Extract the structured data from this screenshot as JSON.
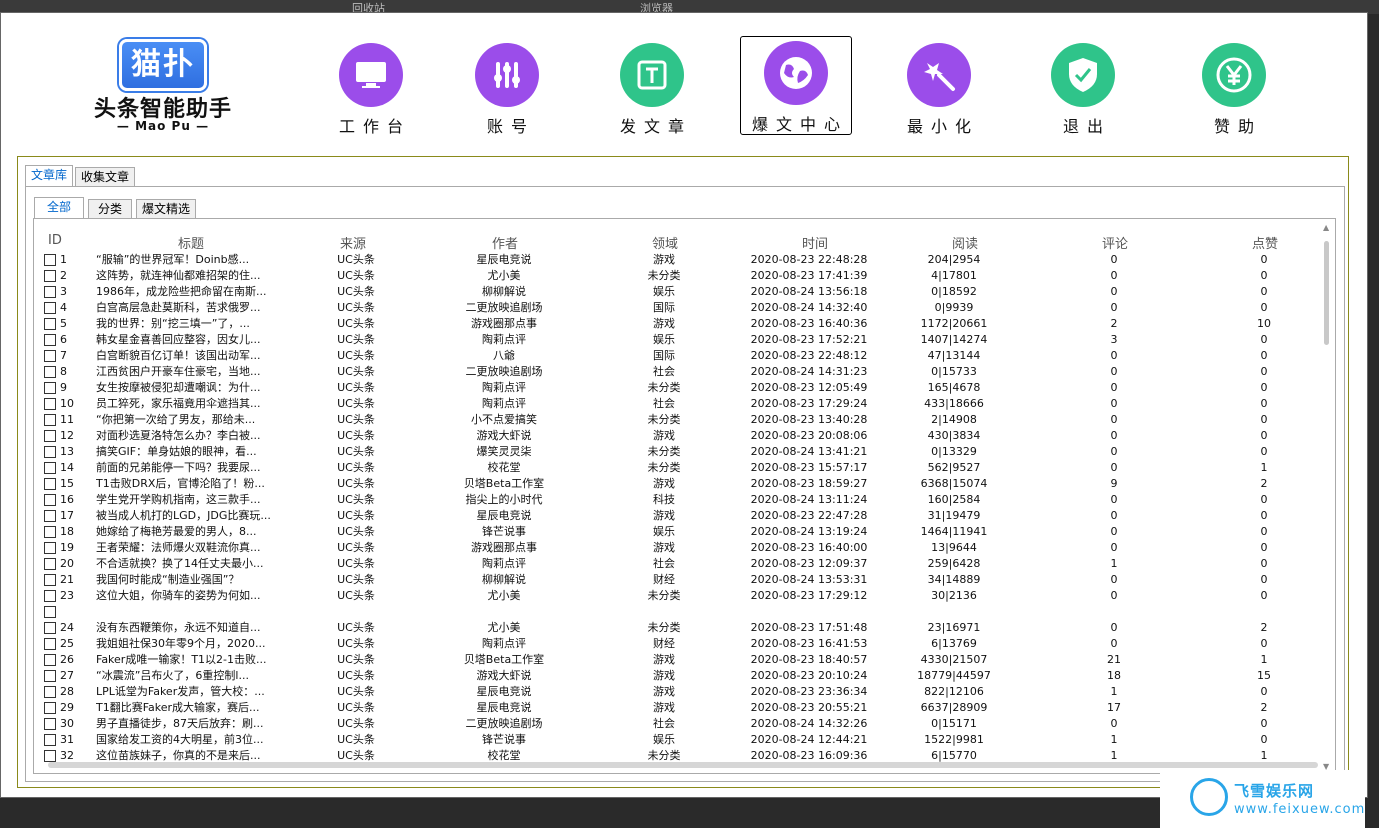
{
  "desktop": {
    "left_text": "回收站",
    "mid_text": "浏览器"
  },
  "logo": {
    "box": "猫扑",
    "title": "头条智能助手",
    "sub": "— Mao Pu —"
  },
  "nav": [
    {
      "label": "工作台",
      "icon": "monitor-icon",
      "color": "#9b4dea"
    },
    {
      "label": "账号",
      "icon": "sliders-icon",
      "color": "#9b4dea"
    },
    {
      "label": "发文章",
      "icon": "text-document-icon",
      "color": "#2fc48a"
    },
    {
      "label": "爆文中心",
      "icon": "globe-icon",
      "color": "#9b4dea"
    },
    {
      "label": "最小化",
      "icon": "magic-wand-icon",
      "color": "#9b4dea"
    },
    {
      "label": "退出",
      "icon": "shield-check-icon",
      "color": "#2fc48a"
    },
    {
      "label": "赞助",
      "icon": "yen-coin-icon",
      "color": "#2fc48a"
    }
  ],
  "outer_tabs": [
    "文章库",
    "收集文章"
  ],
  "inner_tabs": [
    "全部",
    "分类",
    "爆文精选"
  ],
  "columns": [
    "ID",
    "标题",
    "来源",
    "作者",
    "领域",
    "时间",
    "阅读",
    "评论",
    "点赞"
  ],
  "rows": [
    [
      "1",
      "“服输”的世界冠军！Doinb感...",
      "UC头条",
      "星辰电竞说",
      "游戏",
      "2020-08-23 22:48:28",
      "204|2954",
      "0",
      "0"
    ],
    [
      "2",
      "这阵势，就连神仙都难招架的住...",
      "UC头条",
      "尤小美",
      "未分类",
      "2020-08-23 17:41:39",
      "4|17801",
      "0",
      "0"
    ],
    [
      "3",
      "1986年，成龙险些把命留在南斯...",
      "UC头条",
      "柳柳解说",
      "娱乐",
      "2020-08-24 13:56:18",
      "0|18592",
      "0",
      "0"
    ],
    [
      "4",
      "白宫高层急赴莫斯科，苦求俄罗...",
      "UC头条",
      "二更放映追剧场",
      "国际",
      "2020-08-24 14:32:40",
      "0|9939",
      "0",
      "0"
    ],
    [
      "5",
      "我的世界：别“挖三填一”了，...",
      "UC头条",
      "游戏圈那点事",
      "游戏",
      "2020-08-23 16:40:36",
      "1172|20661",
      "2",
      "10"
    ],
    [
      "6",
      "韩女星金喜善回应整容，因女儿...",
      "UC头条",
      "陶莉点评",
      "娱乐",
      "2020-08-23 17:52:21",
      "1407|14274",
      "3",
      "0"
    ],
    [
      "7",
      "白宫断貌百亿订单！该国出动军...",
      "UC头条",
      "八爺",
      "国际",
      "2020-08-23 22:48:12",
      "47|13144",
      "0",
      "0"
    ],
    [
      "8",
      "江西贫困户开豪车住豪宅，当地...",
      "UC头条",
      "二更放映追剧场",
      "社会",
      "2020-08-24 14:31:23",
      "0|15733",
      "0",
      "0"
    ],
    [
      "9",
      "女生按摩被侵犯却遭嘲讽：为什...",
      "UC头条",
      "陶莉点评",
      "未分类",
      "2020-08-23 12:05:49",
      "165|4678",
      "0",
      "0"
    ],
    [
      "10",
      "员工猝死，家乐福竟用伞遮挡其...",
      "UC头条",
      "陶莉点评",
      "社会",
      "2020-08-23 17:29:24",
      "433|18666",
      "0",
      "0"
    ],
    [
      "11",
      "“你把第一次给了男友，那给未...",
      "UC头条",
      "小不点爱搞笑",
      "未分类",
      "2020-08-23 13:40:28",
      "2|14908",
      "0",
      "0"
    ],
    [
      "12",
      "对面秒选夏洛特怎么办？李白被...",
      "UC头条",
      "游戏大虾说",
      "游戏",
      "2020-08-23 20:08:06",
      "430|3834",
      "0",
      "0"
    ],
    [
      "13",
      "搞笑GIF：单身姑娘的眼神，看...",
      "UC头条",
      "爆笑灵灵柒",
      "未分类",
      "2020-08-24 13:41:21",
      "0|13329",
      "0",
      "0"
    ],
    [
      "14",
      "前面的兄弟能停一下吗？我要尿...",
      "UC头条",
      "校花堂",
      "未分类",
      "2020-08-23 15:57:17",
      "562|9527",
      "0",
      "1"
    ],
    [
      "15",
      "T1击败DRX后，官博沦陷了！粉...",
      "UC头条",
      "贝塔Beta工作室",
      "游戏",
      "2020-08-23 18:59:27",
      "6368|15074",
      "9",
      "2"
    ],
    [
      "16",
      "学生党开学购机指南，这三款手...",
      "UC头条",
      "指尖上的小时代",
      "科技",
      "2020-08-24 13:11:24",
      "160|2584",
      "0",
      "0"
    ],
    [
      "17",
      "被当成人机打的LGD，JDG比赛玩...",
      "UC头条",
      "星辰电竞说",
      "游戏",
      "2020-08-23 22:47:28",
      "31|19479",
      "0",
      "0"
    ],
    [
      "18",
      "她嫁给了梅艳芳最爱的男人，8...",
      "UC头条",
      "锋芒说事",
      "娱乐",
      "2020-08-24 13:19:24",
      "1464|11941",
      "0",
      "0"
    ],
    [
      "19",
      "王者荣耀：法师爆火双鞋流你真...",
      "UC头条",
      "游戏圈那点事",
      "游戏",
      "2020-08-23 16:40:00",
      "13|9644",
      "0",
      "0"
    ],
    [
      "20",
      "不合适就换？换了14任丈夫最小...",
      "UC头条",
      "陶莉点评",
      "社会",
      "2020-08-23 12:09:37",
      "259|6428",
      "1",
      "0"
    ],
    [
      "21",
      "我国何时能成“制造业强国”？",
      "UC头条",
      "柳柳解说",
      "财经",
      "2020-08-24 13:53:31",
      "34|14889",
      "0",
      "0"
    ],
    [
      "23",
      "这位大姐，你骑车的姿势为何如...",
      "UC头条",
      "尤小美",
      "未分类",
      "2020-08-23 17:29:12",
      "30|2136",
      "0",
      "0"
    ],
    [
      "",
      "",
      "",
      "",
      "",
      "",
      "",
      "",
      ""
    ],
    [
      "24",
      "没有东西鞭策你，永远不知道自...",
      "UC头条",
      "尤小美",
      "未分类",
      "2020-08-23 17:51:48",
      "23|16971",
      "0",
      "2"
    ],
    [
      "25",
      "我姐姐社保30年零9个月，2020...",
      "UC头条",
      "陶莉点评",
      "财经",
      "2020-08-23 16:41:53",
      "6|13769",
      "0",
      "0"
    ],
    [
      "26",
      "Faker成唯一输家！T1以2-1击败...",
      "UC头条",
      "贝塔Beta工作室",
      "游戏",
      "2020-08-23 18:40:57",
      "4330|21507",
      "21",
      "1"
    ],
    [
      "27",
      "“冰震流”吕布火了，6重控制l...",
      "UC头条",
      "游戏大虾说",
      "游戏",
      "2020-08-23 20:10:24",
      "18779|44597",
      "18",
      "15"
    ],
    [
      "28",
      "LPL诋堂为Faker发声，管大校：...",
      "UC头条",
      "星辰电竞说",
      "游戏",
      "2020-08-23 23:36:34",
      "822|12106",
      "1",
      "0"
    ],
    [
      "29",
      "T1翻比赛Faker成大输家，赛后...",
      "UC头条",
      "星辰电竞说",
      "游戏",
      "2020-08-23 20:55:21",
      "6637|28909",
      "17",
      "2"
    ],
    [
      "30",
      "男子直播徒步，87天后放弃：刷...",
      "UC头条",
      "二更放映追剧场",
      "社会",
      "2020-08-24 14:32:26",
      "0|15171",
      "0",
      "0"
    ],
    [
      "31",
      "国家给发工资的4大明星，前3位...",
      "UC头条",
      "锋芒说事",
      "娱乐",
      "2020-08-24 12:44:21",
      "1522|9981",
      "1",
      "0"
    ],
    [
      "32",
      "这位苗族妹子，你真的不是来后...",
      "UC头条",
      "校花堂",
      "未分类",
      "2020-08-23 16:09:36",
      "6|15770",
      "1",
      "1"
    ]
  ],
  "watermark": {
    "title": "飞雪娱乐网",
    "url": "www.feixuew.com"
  }
}
